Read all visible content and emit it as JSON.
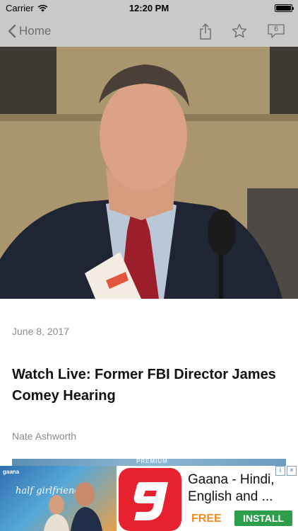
{
  "status_bar": {
    "carrier": "Carrier",
    "time": "12:20 PM",
    "battery_level": 1.0
  },
  "nav": {
    "back_label": "Home",
    "comment_count": "6",
    "icons": [
      "chevron-left-icon",
      "share-icon",
      "star-icon",
      "comment-icon"
    ]
  },
  "article": {
    "date": "June 8, 2017",
    "title": "Watch Live: Former FBI Director James Comey Hearing",
    "author": "Nate Ashworth",
    "banner_text": "PREMIUM"
  },
  "ad": {
    "poster_brand": "gaana",
    "poster_title": "half girlfriend",
    "app_name": "Gaana - Hindi, English and ...",
    "price": "FREE",
    "install_label": "INSTALL",
    "choices_icons": [
      "info-icon",
      "close-icon"
    ]
  },
  "colors": {
    "bar_background": "#c9c9c9",
    "nav_tint": "#6f6f6f",
    "app_icon_red": "#e8212f",
    "install_green": "#2f9e4b",
    "price_orange": "#f28b1c"
  }
}
